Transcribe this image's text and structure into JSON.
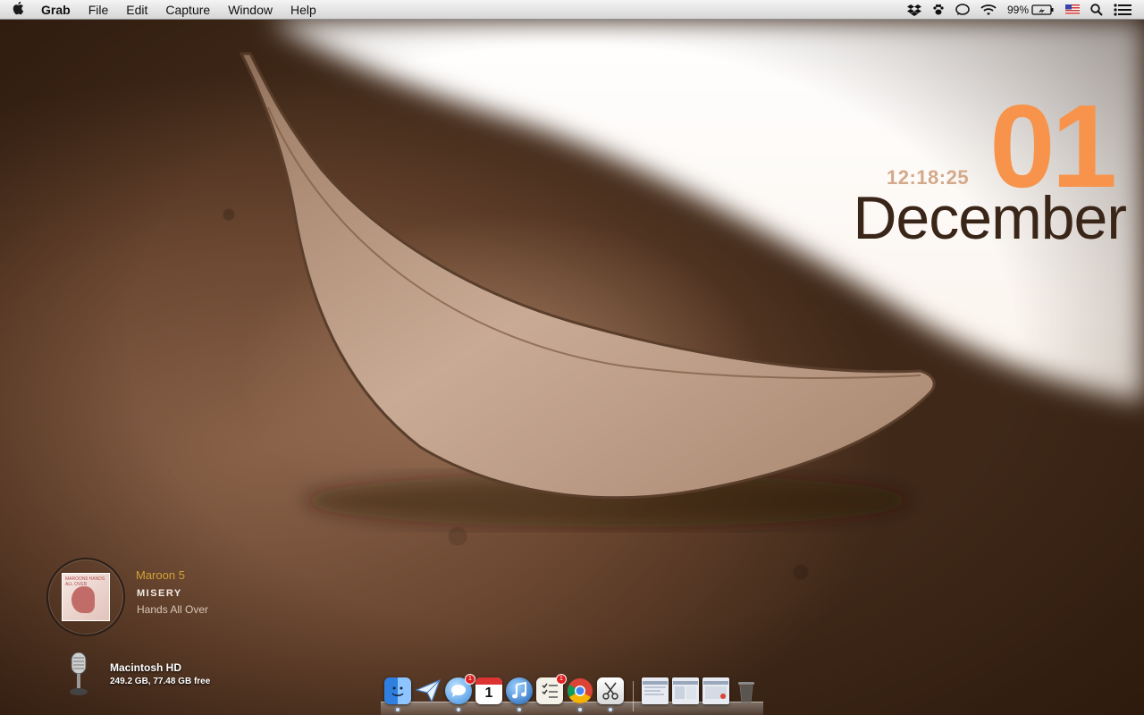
{
  "menubar": {
    "app_name": "Grab",
    "items": [
      "File",
      "Edit",
      "Capture",
      "Window",
      "Help"
    ],
    "status_icons": [
      "dropbox-icon",
      "paw-icon",
      "speech-bubble-icon",
      "wifi-icon",
      "battery-icon",
      "us-flag-icon",
      "spotlight-search-icon",
      "notification-center-icon"
    ],
    "battery_percent": "99%"
  },
  "clock": {
    "day": "01",
    "time": "12:18:25",
    "month": "December"
  },
  "music": {
    "artist": "Maroon 5",
    "track": "MISERY",
    "album": "Hands All Over",
    "art_text": "MAROON5 HANDS ALL OVER"
  },
  "disk": {
    "name": "Macintosh HD",
    "info": "249.2 GB, 77.48 GB free"
  },
  "dock": {
    "calendar_day": "1",
    "items": [
      {
        "name": "finder",
        "icon": "finder-icon",
        "running": true,
        "badge": ""
      },
      {
        "name": "mail",
        "icon": "paper-plane-icon",
        "running": false,
        "badge": ""
      },
      {
        "name": "messages",
        "icon": "speech-bubble-icon",
        "running": true,
        "badge": "1"
      },
      {
        "name": "calendar",
        "icon": "calendar-icon",
        "running": false,
        "badge": ""
      },
      {
        "name": "itunes",
        "icon": "music-note-icon",
        "running": true,
        "badge": ""
      },
      {
        "name": "reminders",
        "icon": "checklist-icon",
        "running": false,
        "badge": "1"
      },
      {
        "name": "chrome",
        "icon": "chrome-icon",
        "running": true,
        "badge": ""
      },
      {
        "name": "grab",
        "icon": "scissors-icon",
        "running": true,
        "badge": ""
      },
      {
        "name": "window-thumb-1",
        "icon": "window-thumbnail-icon",
        "running": false,
        "badge": ""
      },
      {
        "name": "window-thumb-2",
        "icon": "window-thumbnail-icon",
        "running": false,
        "badge": ""
      },
      {
        "name": "window-thumb-3",
        "icon": "window-thumbnail-icon",
        "running": false,
        "badge": ""
      },
      {
        "name": "trash",
        "icon": "trash-icon",
        "running": false,
        "badge": ""
      }
    ]
  }
}
